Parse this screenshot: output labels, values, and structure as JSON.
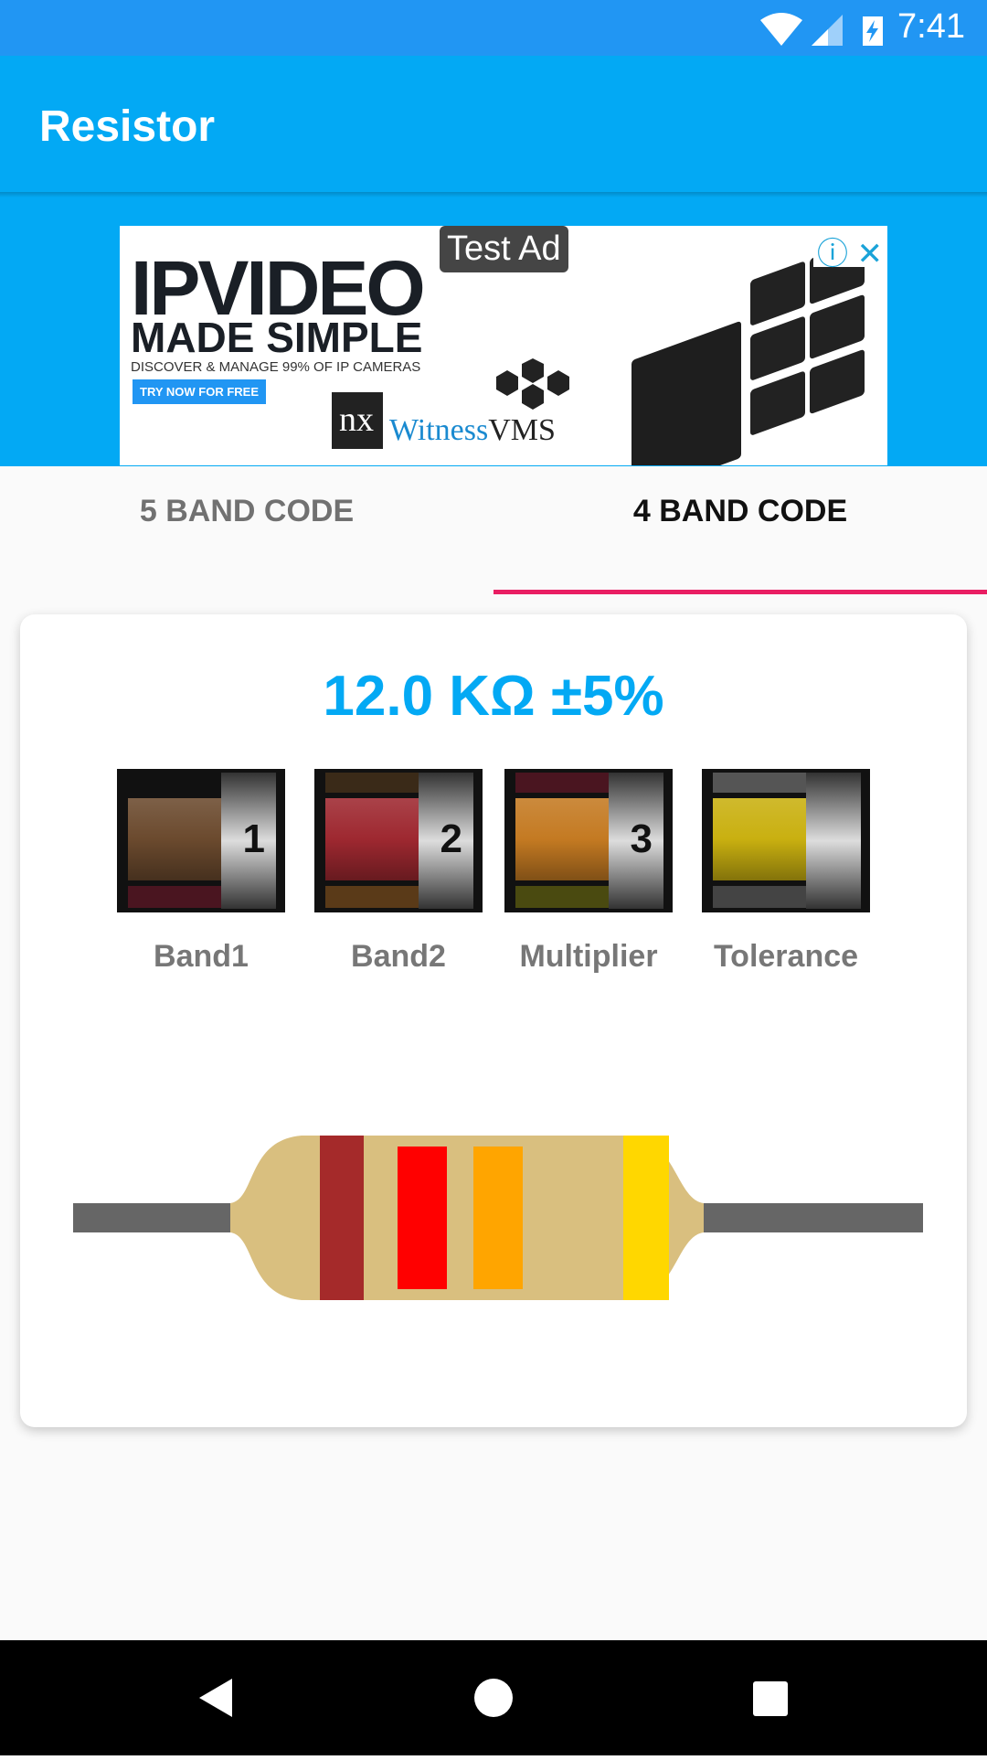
{
  "status_bar": {
    "time": "7:41",
    "icons": [
      "wifi-icon",
      "signal-icon",
      "battery-charging-icon"
    ]
  },
  "app_bar": {
    "title": "Resistor"
  },
  "ad": {
    "badge": "Test Ad",
    "headline": "IPVIDEO",
    "subheadline": "MADE SIMPLE",
    "tagline": "DISCOVER & MANAGE 99% OF IP CAMERAS",
    "cta": "TRY NOW FOR FREE",
    "logo": "nx",
    "brand_a": "Witness",
    "brand_b": "VMS",
    "icons": [
      "info-icon",
      "close-icon"
    ]
  },
  "tabs": [
    {
      "label": "5 BAND CODE",
      "active": false
    },
    {
      "label": "4 BAND CODE",
      "active": true
    }
  ],
  "colors": {
    "accent": "#03A9F4",
    "indicator": "#E91E63"
  },
  "result": {
    "value": "12.0 KΩ ±5%"
  },
  "bands": [
    {
      "label": "Band1",
      "number": "1",
      "selected": "brown",
      "color": "#6b4a2e",
      "above": "#111111",
      "below": "#4a1520"
    },
    {
      "label": "Band2",
      "number": "2",
      "selected": "red",
      "color": "#9e2830",
      "above": "#3a2a18",
      "below": "#5a3a18"
    },
    {
      "label": "Multiplier",
      "number": "3",
      "selected": "orange",
      "color": "#c47a22",
      "above": "#4a1520",
      "below": "#4a4a10"
    },
    {
      "label": "Tolerance",
      "number": "",
      "selected": "gold",
      "color": "#c9b010",
      "above": "#555555",
      "below": "#444444"
    }
  ],
  "resistor": {
    "body": "#d9bf7f",
    "lead": "#666666",
    "stripes": [
      "#a52a2a",
      "#ff0000",
      "#ffa500",
      "#ffd700"
    ]
  }
}
